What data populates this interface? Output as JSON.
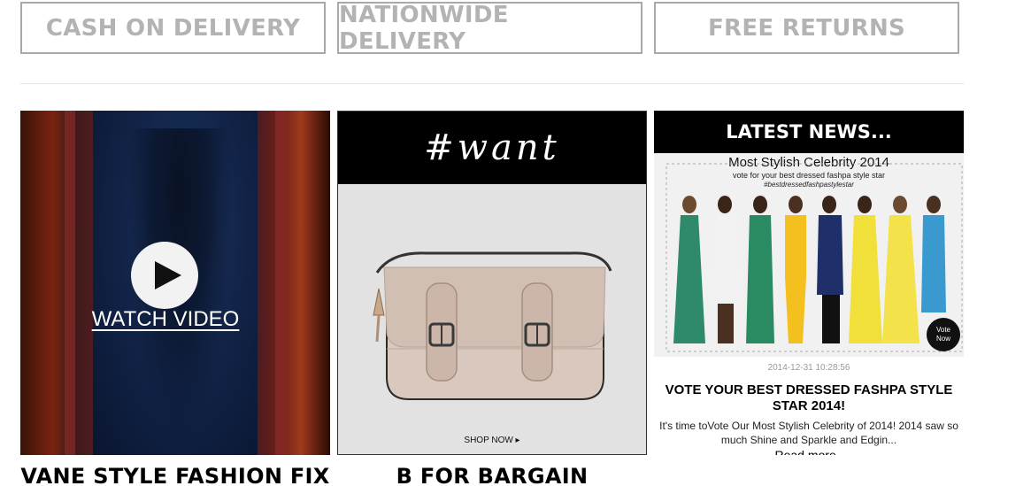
{
  "features": {
    "cod": "CASH ON DELIVERY",
    "nationwide": "NATIONWIDE DELIVERY",
    "returns": "FREE RETURNS"
  },
  "video_tile": {
    "watch_label": "WATCH VIDEO",
    "caption": "VANE STYLE FASHION FIX"
  },
  "promo_tile": {
    "banner": "#want",
    "shop_now": "SHOP NOW ▸",
    "caption": "B FOR BARGAIN"
  },
  "news_tile": {
    "heading": "LATEST NEWS...",
    "image_title": "Most Stylish Celebrity 2014",
    "image_subtitle": "vote for your best dressed fashpa style star",
    "image_hashtag": "#bestdressedfashpastylestar",
    "vote_badge_line1": "Vote",
    "vote_badge_line2": "Now",
    "date": "2014-12-31 10:28:56",
    "headline": "VOTE YOUR BEST DRESSED FASHPA STYLE STAR 2014!",
    "excerpt": "It's time toVote Our Most Stylish Celebrity of 2014! 2014 saw so much Shine and Sparkle and Edgin...",
    "read_more": "Read more.."
  },
  "colors": {
    "feature_text": "#b3b3b3",
    "feature_border": "#a9a9a9",
    "banner_bg": "#000000"
  }
}
